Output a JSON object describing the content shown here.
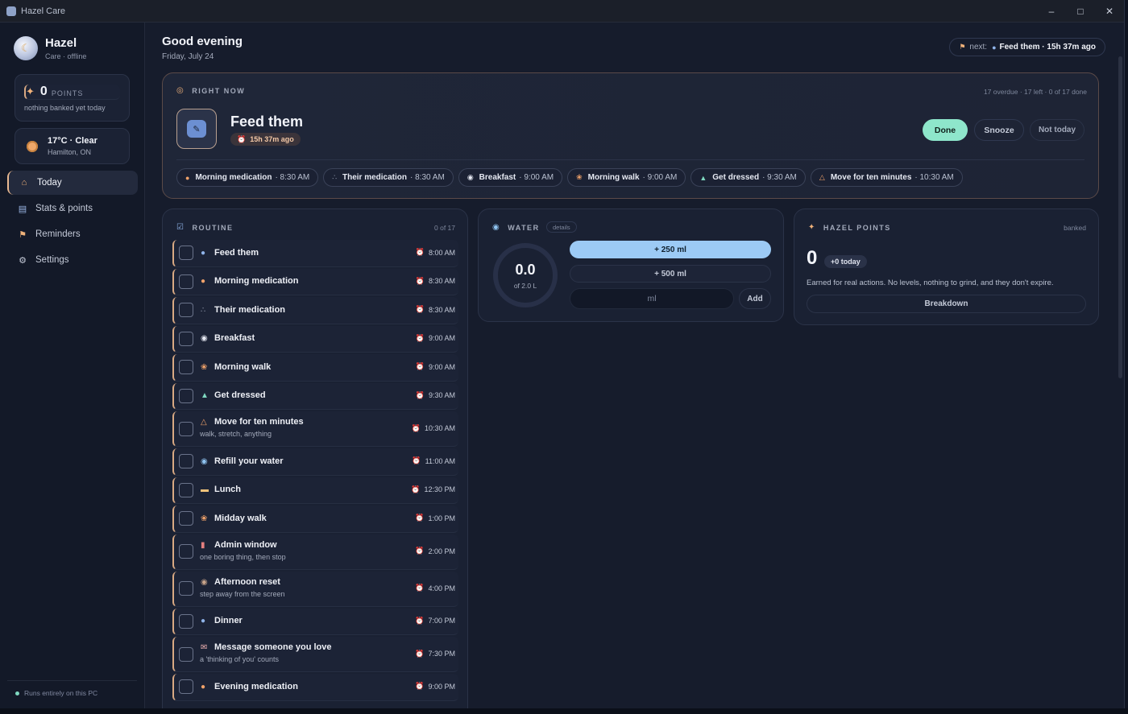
{
  "window": {
    "title": "Hazel Care"
  },
  "sidebar": {
    "name": "Hazel",
    "status": "Care · offline",
    "points": {
      "value": "0",
      "unit": "POINTS",
      "sub": "nothing banked yet today"
    },
    "weather": {
      "temp": "17°C · Clear",
      "location": "Hamilton, ON"
    },
    "nav": [
      {
        "label": "Today",
        "icon": "home-icon",
        "active": true
      },
      {
        "label": "Stats & points",
        "icon": "chart-icon",
        "active": false
      },
      {
        "label": "Reminders",
        "icon": "bell-icon",
        "active": false
      },
      {
        "label": "Settings",
        "icon": "gear-icon",
        "active": false
      }
    ],
    "footer": "Runs entirely on this PC"
  },
  "header": {
    "greeting": "Good evening",
    "date": "Friday, July 24",
    "next_label": "next:",
    "next_value": "Feed them · 15h 37m ago"
  },
  "right_now": {
    "label": "RIGHT NOW",
    "meta": "17 overdue · 17 left · 0 of 17 done",
    "task": "Feed them",
    "ago": "15h 37m ago",
    "done": "Done",
    "snooze": "Snooze",
    "not_today": "Not today",
    "chips": [
      {
        "label": "Morning medication",
        "time": "· 8:30 AM",
        "icon": "pill-icon"
      },
      {
        "label": "Their medication",
        "time": "· 8:30 AM",
        "icon": "paw-icon"
      },
      {
        "label": "Breakfast",
        "time": "· 9:00 AM",
        "icon": "egg-icon"
      },
      {
        "label": "Morning walk",
        "time": "· 9:00 AM",
        "icon": "dog-icon"
      },
      {
        "label": "Get dressed",
        "time": "· 9:30 AM",
        "icon": "shirt-icon"
      },
      {
        "label": "Move for ten minutes",
        "time": "· 10:30 AM",
        "icon": "stretch-icon"
      }
    ]
  },
  "routine": {
    "label": "ROUTINE",
    "count": "0 of 17",
    "items": [
      {
        "label": "Feed them",
        "sub": "",
        "time": "8:00 AM",
        "icon": "bowl-icon"
      },
      {
        "label": "Morning medication",
        "sub": "",
        "time": "8:30 AM",
        "icon": "pill-icon"
      },
      {
        "label": "Their medication",
        "sub": "",
        "time": "8:30 AM",
        "icon": "paw-icon"
      },
      {
        "label": "Breakfast",
        "sub": "",
        "time": "9:00 AM",
        "icon": "egg-icon"
      },
      {
        "label": "Morning walk",
        "sub": "",
        "time": "9:00 AM",
        "icon": "dog-icon"
      },
      {
        "label": "Get dressed",
        "sub": "",
        "time": "9:30 AM",
        "icon": "shirt-icon"
      },
      {
        "label": "Move for ten minutes",
        "sub": "walk, stretch, anything",
        "time": "10:30 AM",
        "icon": "stretch-icon"
      },
      {
        "label": "Refill your water",
        "sub": "",
        "time": "11:00 AM",
        "icon": "drop-icon"
      },
      {
        "label": "Lunch",
        "sub": "",
        "time": "12:30 PM",
        "icon": "sandwich-icon"
      },
      {
        "label": "Midday walk",
        "sub": "",
        "time": "1:00 PM",
        "icon": "dog-icon"
      },
      {
        "label": "Admin window",
        "sub": "one boring thing, then stop",
        "time": "2:00 PM",
        "icon": "clipboard-icon"
      },
      {
        "label": "Afternoon reset",
        "sub": "step away from the screen",
        "time": "4:00 PM",
        "icon": "cup-icon"
      },
      {
        "label": "Dinner",
        "sub": "",
        "time": "7:00 PM",
        "icon": "bowl-icon"
      },
      {
        "label": "Message someone you love",
        "sub": "a 'thinking of you' counts",
        "time": "7:30 PM",
        "icon": "envelope-icon"
      },
      {
        "label": "Evening medication",
        "sub": "",
        "time": "9:00 PM",
        "icon": "pill-icon"
      }
    ]
  },
  "water": {
    "label": "WATER",
    "details": "details",
    "value": "0.0",
    "of": "of 2.0 L",
    "btn1": "+ 250 ml",
    "btn2": "+ 500 ml",
    "input_placeholder": "ml",
    "add": "Add"
  },
  "hazel_points": {
    "label": "HAZEL POINTS",
    "banked": "banked",
    "value": "0",
    "today": "+0 today",
    "desc": "Earned for real actions. No levels, nothing to grind, and they don't expire.",
    "breakdown": "Breakdown"
  },
  "colors": {
    "accent_done": "#8ee6cb",
    "water_button": "#9ccaf5",
    "row_border": "#d9a983",
    "alarm": "#f0a26a"
  }
}
